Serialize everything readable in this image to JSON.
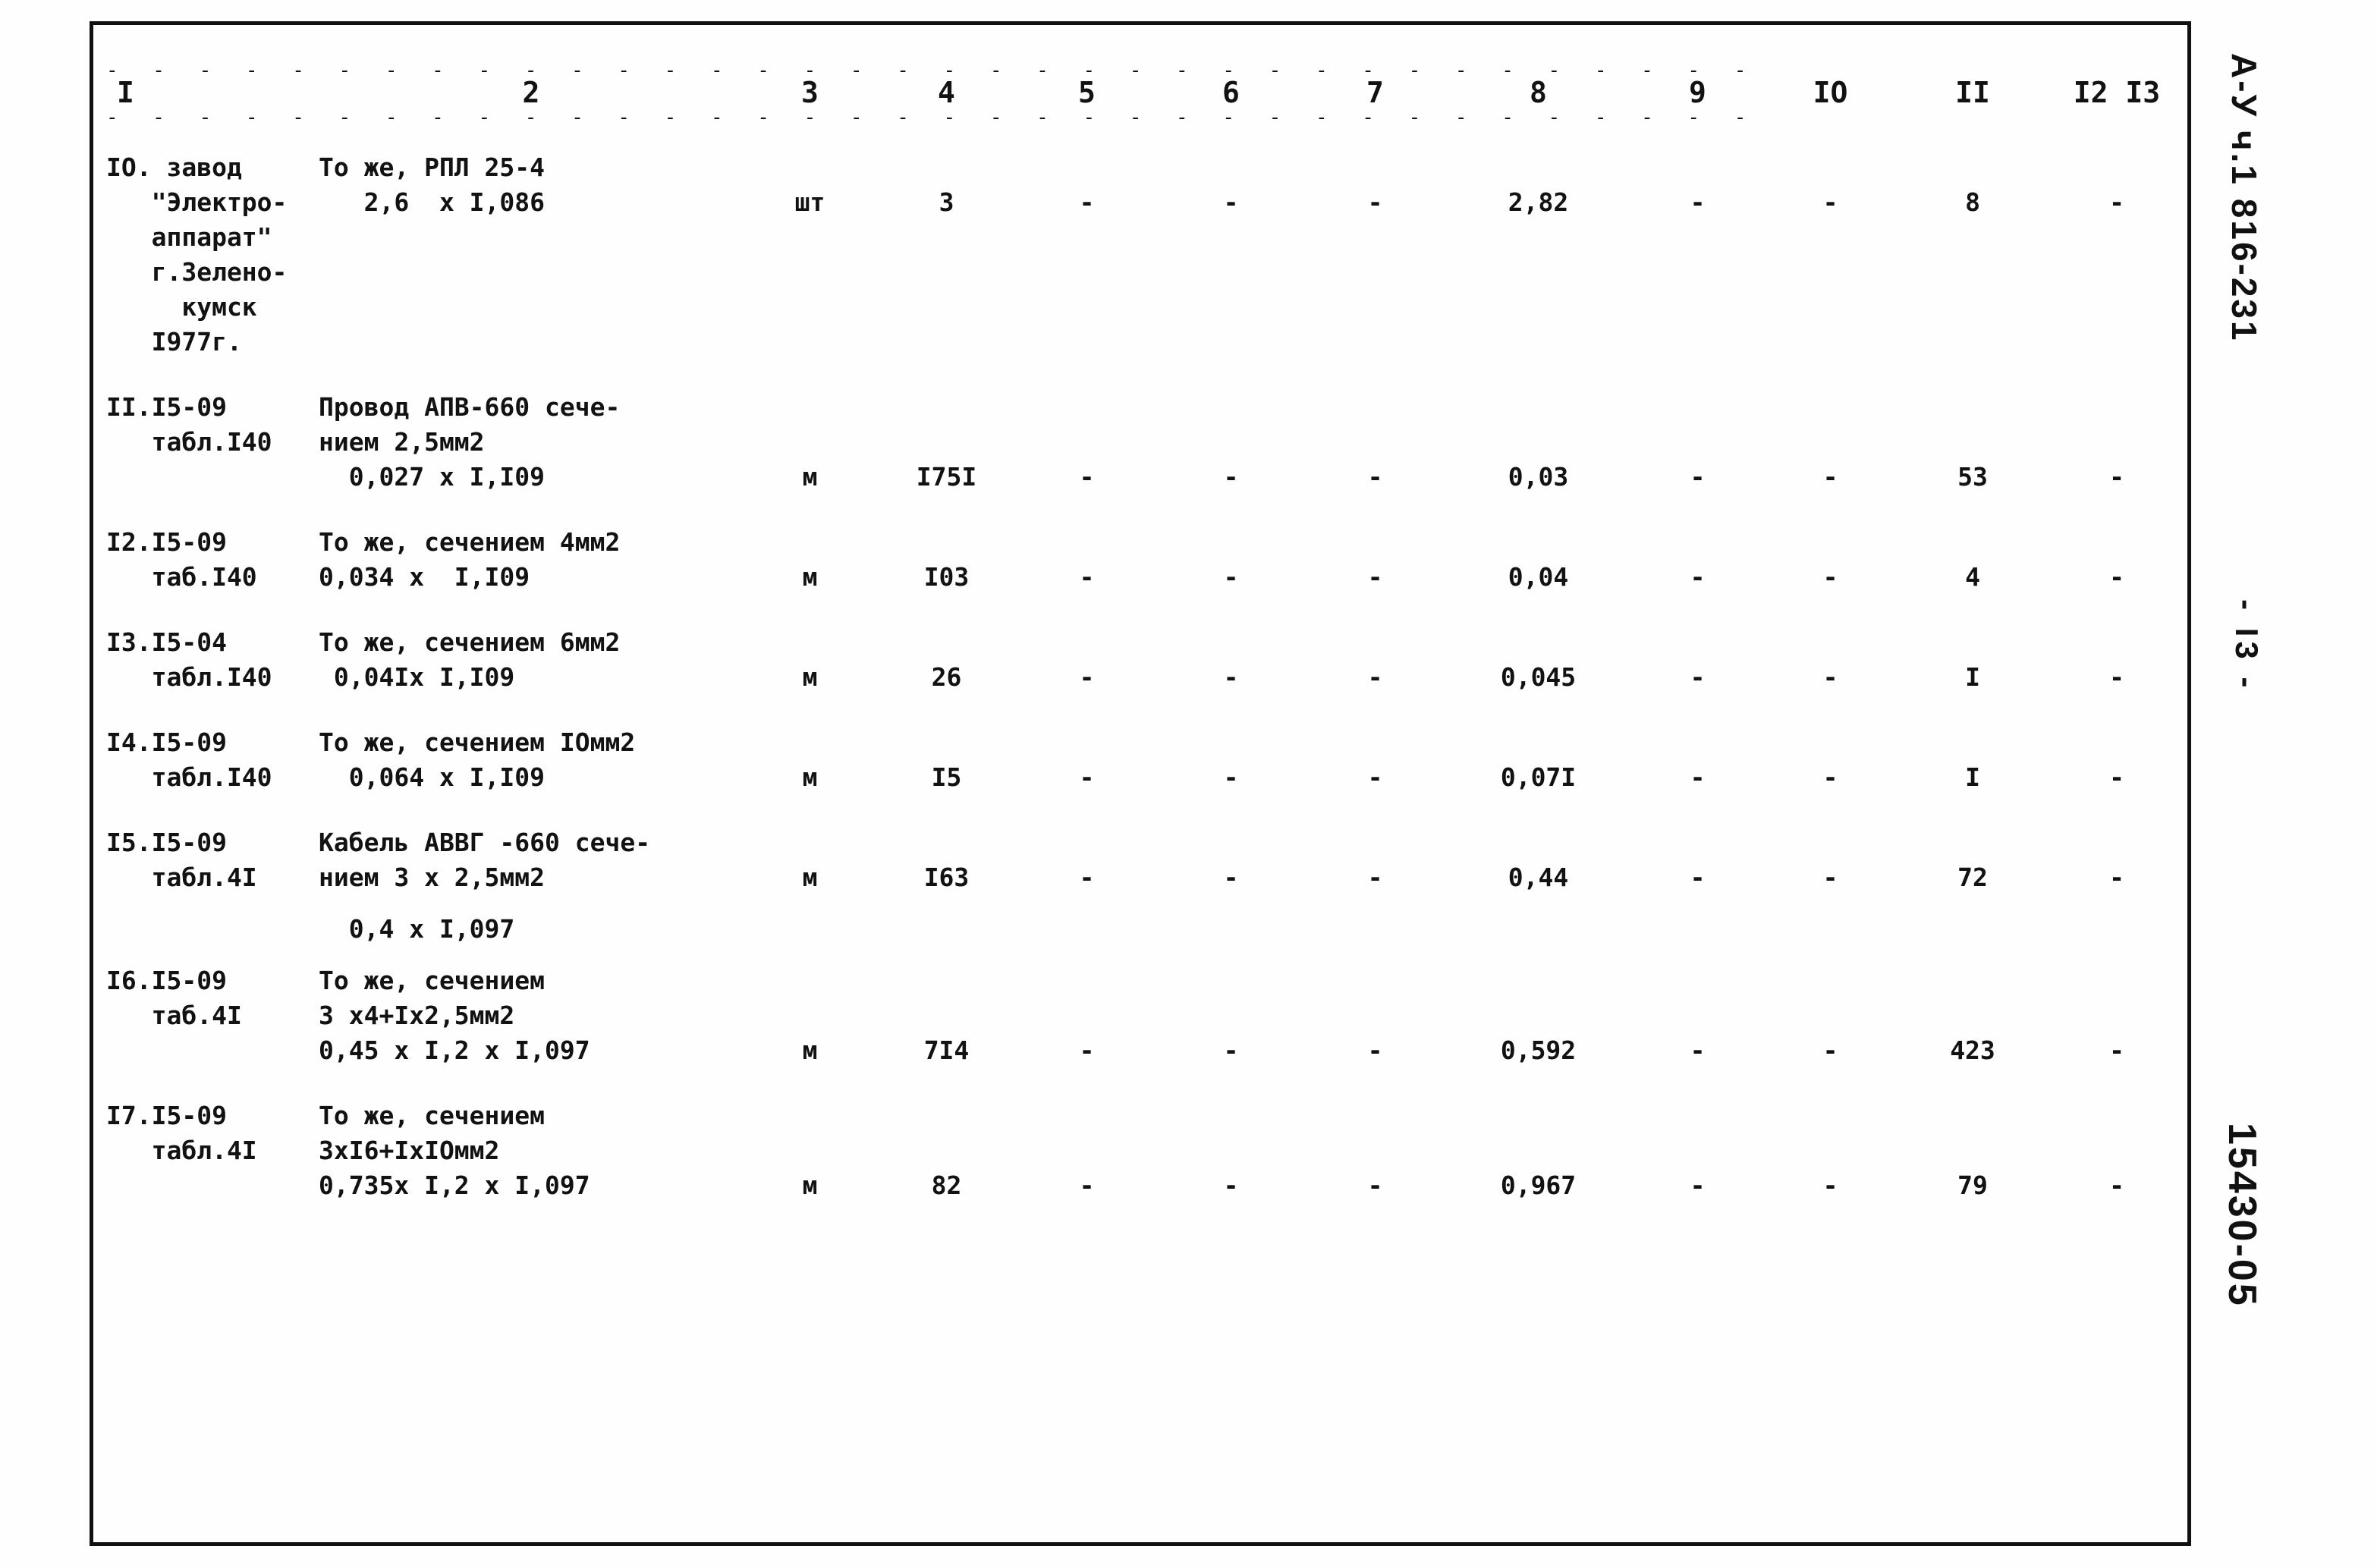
{
  "document": {
    "type": "estimate-table",
    "column_headers": [
      "I",
      "2",
      "3",
      "4",
      "5",
      "6",
      "7",
      "8",
      "9",
      "IO",
      "II",
      "I2",
      "I3"
    ],
    "dash_separator": "- - - - - - - - - - - - - - - - - - - - - - - - - - - - - - - - - - - -"
  },
  "margin_notes": {
    "code_top": "А-У ч.1 816-231",
    "page_number": "- I3 -",
    "code_bottom": "15430-05"
  },
  "rows": [
    {
      "pos_lines": [
        "IO. завод",
        "   \"Электро-",
        "   аппарат\"",
        "   г.Зелено-",
        "     кумск",
        "   I977г."
      ],
      "descr_lines": [
        "То же, РПЛ 25-4",
        "   2,6  x I,086"
      ],
      "unit": "шт",
      "qty": "3",
      "c6": "-",
      "c7": "-",
      "c8": "-",
      "c9": "2,82",
      "c10": "-",
      "c11": "-",
      "c12": "8",
      "c13": "-"
    },
    {
      "pos_lines": [
        "II.I5-09",
        "   табл.I40"
      ],
      "descr_lines": [
        "Провод АПВ-660 сече-",
        "нием 2,5мм2",
        "  0,027 x I,I09"
      ],
      "unit": "м",
      "qty": "I75I",
      "c6": "-",
      "c7": "-",
      "c8": "-",
      "c9": "0,03",
      "c10": "-",
      "c11": "-",
      "c12": "53",
      "c13": "-"
    },
    {
      "pos_lines": [
        "I2.I5-09",
        "   таб.I40"
      ],
      "descr_lines": [
        "То же, сечением 4мм2",
        "0,034 x  I,I09"
      ],
      "unit": "м",
      "qty": "I03",
      "c6": "-",
      "c7": "-",
      "c8": "-",
      "c9": "0,04",
      "c10": "-",
      "c11": "-",
      "c12": "4",
      "c13": "-"
    },
    {
      "pos_lines": [
        "I3.I5-04",
        "   табл.I40"
      ],
      "descr_lines": [
        "То же, сечением 6мм2",
        " 0,04Iх I,I09"
      ],
      "unit": "м",
      "qty": "26",
      "c6": "-",
      "c7": "-",
      "c8": "-",
      "c9": "0,045",
      "c10": "-",
      "c11": "-",
      "c12": "I",
      "c13": "-"
    },
    {
      "pos_lines": [
        "I4.I5-09",
        "   табл.I40"
      ],
      "descr_lines": [
        "То же, сечением IOмм2",
        "  0,064 x I,I09"
      ],
      "unit": "м",
      "qty": "I5",
      "c6": "-",
      "c7": "-",
      "c8": "-",
      "c9": "0,07I",
      "c10": "-",
      "c11": "-",
      "c12": "I",
      "c13": "-"
    },
    {
      "pos_lines": [
        "I5.I5-09",
        "   табл.4I"
      ],
      "descr_lines": [
        "Кабель АВВГ -660 сече-",
        "нием 3 x 2,5мм2"
      ],
      "unit": "м",
      "qty": "I63",
      "c6": "-",
      "c7": "-",
      "c8": "-",
      "c9": "0,44",
      "c10": "-",
      "c11": "-",
      "c12": "72",
      "c13": "-"
    },
    {
      "pos_lines": [
        ""
      ],
      "descr_lines": [
        "  0,4 x I,097"
      ],
      "unit": "",
      "qty": "",
      "c6": "",
      "c7": "",
      "c8": "",
      "c9": "",
      "c10": "",
      "c11": "",
      "c12": "",
      "c13": ""
    },
    {
      "pos_lines": [
        "I6.I5-09",
        "   таб.4I"
      ],
      "descr_lines": [
        "То же, сечением",
        "3 х4+Iх2,5мм2",
        "0,45 x I,2 x I,097"
      ],
      "unit": "м",
      "qty": "7I4",
      "c6": "-",
      "c7": "-",
      "c8": "-",
      "c9": "0,592",
      "c10": "-",
      "c11": "-",
      "c12": "423",
      "c13": "-"
    },
    {
      "pos_lines": [
        "I7.I5-09",
        "   табл.4I"
      ],
      "descr_lines": [
        "То же, сечением",
        "3хI6+IхIOмм2",
        "0,735х I,2 x I,097"
      ],
      "unit": "м",
      "qty": "82",
      "c6": "-",
      "c7": "-",
      "c8": "-",
      "c9": "0,967",
      "c10": "-",
      "c11": "-",
      "c12": "79",
      "c13": "-"
    }
  ]
}
